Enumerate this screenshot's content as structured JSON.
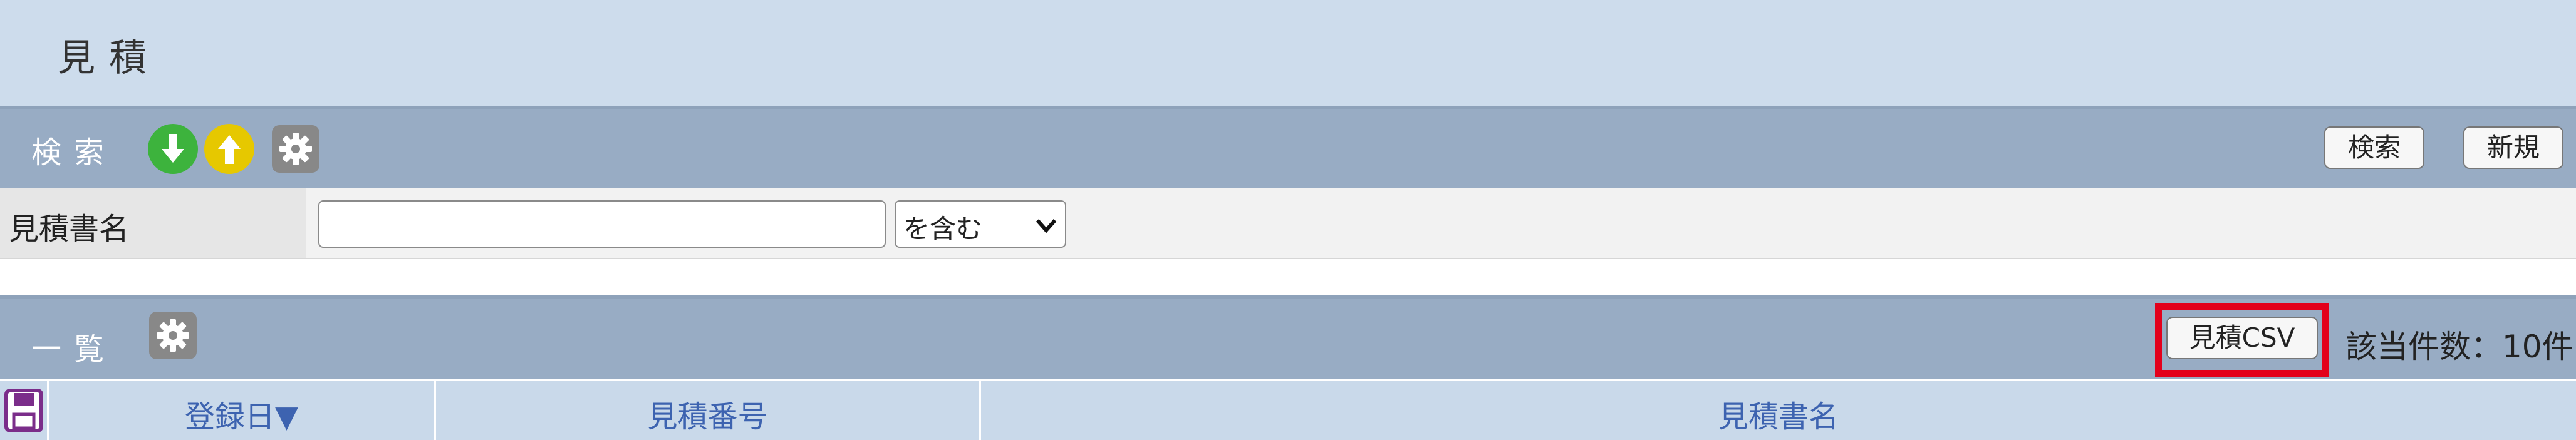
{
  "page": {
    "title": "見積"
  },
  "search_panel": {
    "label": "検索",
    "icons": [
      "arrow-down-icon",
      "arrow-up-icon",
      "gear-icon"
    ],
    "buttons": {
      "search": "検索",
      "new": "新規"
    },
    "field": {
      "label": "見積書名",
      "value": "",
      "placeholder": "",
      "match_option": "を含む"
    }
  },
  "list_panel": {
    "label": "一覧",
    "csv_button": "見積CSV",
    "count_text": "該当件数：10件",
    "columns": [
      "登録日▼",
      "見積番号",
      "見積書名"
    ]
  },
  "colors": {
    "title_bg": "#cddcec",
    "panel_bg": "#98acc4",
    "header_bg": "#c9d9ea",
    "header_text": "#3d63b0",
    "download_green": "#3db33d",
    "upload_yellow": "#e6c800",
    "highlight_red": "#e3001b"
  }
}
